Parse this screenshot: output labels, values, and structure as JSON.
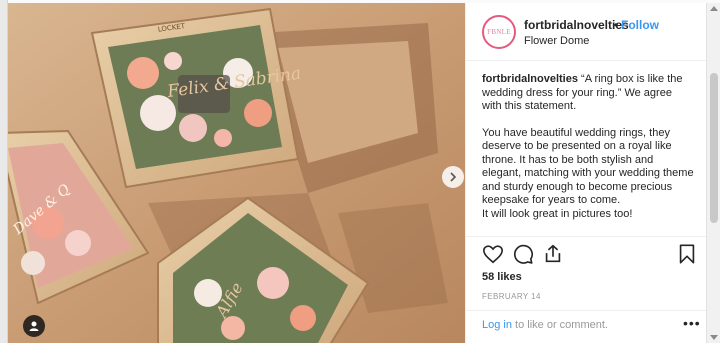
{
  "post": {
    "username": "fortbridalnovelties",
    "separator": "•",
    "follow_label": "Follow",
    "location": "Flower Dome",
    "avatar_text": "FBNLE"
  },
  "caption": {
    "username": "fortbridalnovelties",
    "first_line": "“A ring box is like the wedding dress for your ring.” We agree with this statement.",
    "body": "You have beautiful wedding rings, they deserve to be presented on a royal like throne. It has to be both stylish and elegant, matching with your wedding theme and sturdy enough to become precious keepsake for years to come.",
    "closing": "It will look great in pictures too!"
  },
  "actions": {
    "like_icon": "heart-icon",
    "comment_icon": "comment-icon",
    "share_icon": "share-icon",
    "save_icon": "bookmark-icon"
  },
  "likes": "58 likes",
  "date": "FEBRUARY 14",
  "login": {
    "link": "Log in",
    "rest": "to like or comment."
  },
  "more_label": "•••",
  "media": {
    "box_text_1": "Felix & Sabrina",
    "box_text_2": "Alfie",
    "box_text_3": "Dave & Q",
    "lid_label": "LOCKET"
  },
  "colors": {
    "link": "#3897f0",
    "text": "#262626",
    "muted": "#999999",
    "wood": "#caa079"
  }
}
